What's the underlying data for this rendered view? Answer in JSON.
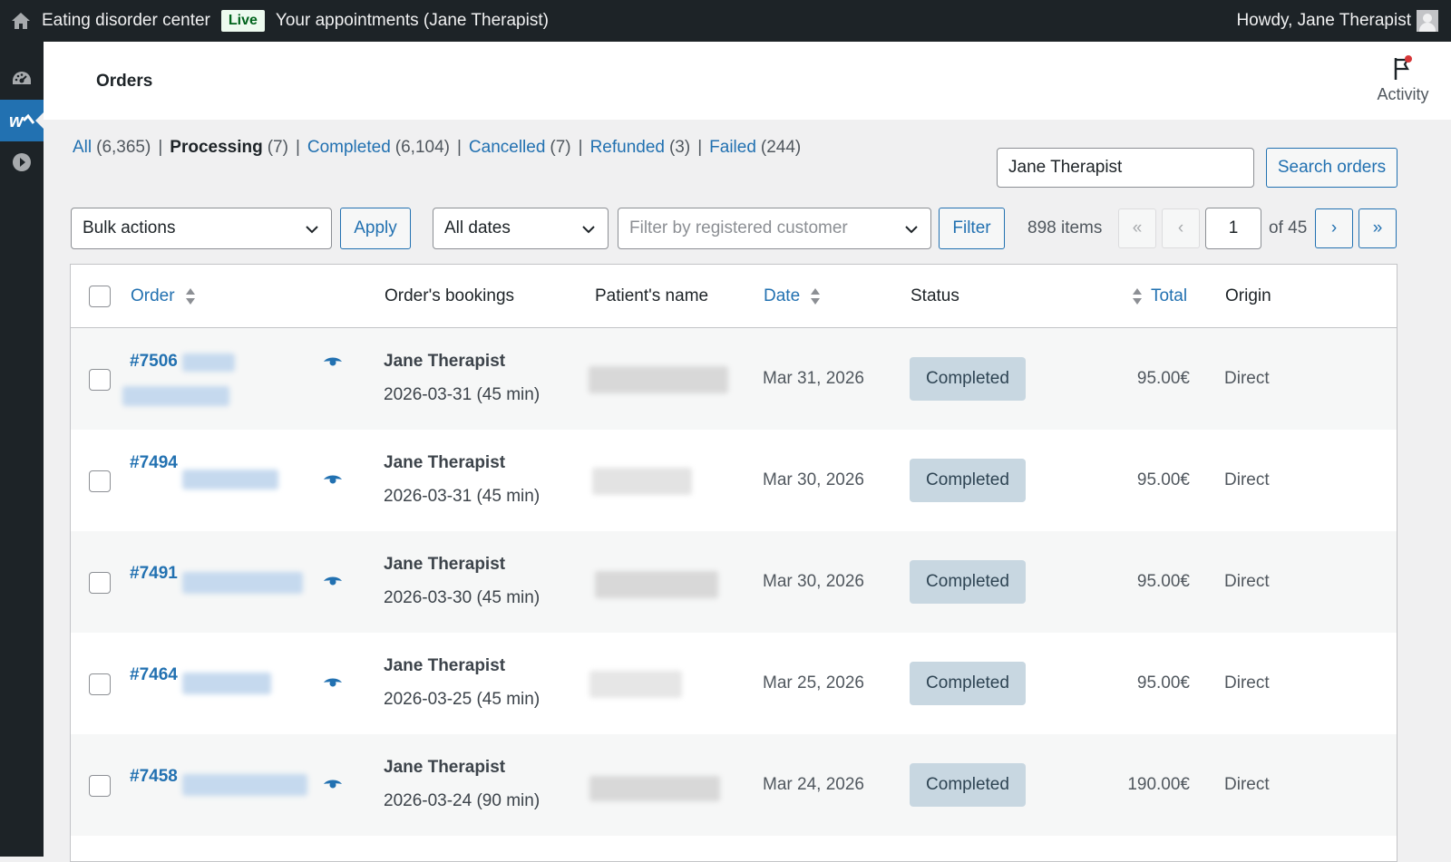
{
  "adminbar": {
    "site_name": "Eating disorder center",
    "live_badge": "Live",
    "appointments_link": "Your appointments (Jane Therapist)",
    "howdy": "Howdy, Jane Therapist"
  },
  "header": {
    "title": "Orders",
    "activity_label": "Activity"
  },
  "status_filters": [
    {
      "label": "All",
      "count": "(6,365)",
      "current": false
    },
    {
      "label": "Processing",
      "count": "(7)",
      "current": true
    },
    {
      "label": "Completed",
      "count": "(6,104)",
      "current": false
    },
    {
      "label": "Cancelled",
      "count": "(7)",
      "current": false
    },
    {
      "label": "Refunded",
      "count": "(3)",
      "current": false
    },
    {
      "label": "Failed",
      "count": "(244)",
      "current": false
    }
  ],
  "search": {
    "value": "Jane Therapist",
    "button_label": "Search orders"
  },
  "toolbar": {
    "bulk_actions": "Bulk actions",
    "apply_label": "Apply",
    "all_dates": "All dates",
    "customer_placeholder": "Filter by registered customer",
    "filter_label": "Filter",
    "items_count": "898 items",
    "first_page": "«",
    "prev_page": "‹",
    "current_page": "1",
    "of_total": "of 45",
    "next_page": "›",
    "last_page": "»"
  },
  "table": {
    "columns": {
      "order": "Order",
      "bookings": "Order's bookings",
      "patient": "Patient's name",
      "date": "Date",
      "status": "Status",
      "total": "Total",
      "origin": "Origin"
    },
    "rows": [
      {
        "number": "#7506",
        "booking_name": "Jane Therapist",
        "booking_detail": "2026-03-31 (45 min)",
        "date": "Mar 31, 2026",
        "status": "Completed",
        "total": "95.00€",
        "origin": "Direct"
      },
      {
        "number": "#7494",
        "booking_name": "Jane Therapist",
        "booking_detail": "2026-03-31 (45 min)",
        "date": "Mar 30, 2026",
        "status": "Completed",
        "total": "95.00€",
        "origin": "Direct"
      },
      {
        "number": "#7491",
        "booking_name": "Jane Therapist",
        "booking_detail": "2026-03-30 (45 min)",
        "date": "Mar 30, 2026",
        "status": "Completed",
        "total": "95.00€",
        "origin": "Direct"
      },
      {
        "number": "#7464",
        "booking_name": "Jane Therapist",
        "booking_detail": "2026-03-25 (45 min)",
        "date": "Mar 25, 2026",
        "status": "Completed",
        "total": "95.00€",
        "origin": "Direct"
      },
      {
        "number": "#7458",
        "booking_name": "Jane Therapist",
        "booking_detail": "2026-03-24 (90 min)",
        "date": "Mar 24, 2026",
        "status": "Completed",
        "total": "190.00€",
        "origin": "Direct"
      }
    ]
  }
}
